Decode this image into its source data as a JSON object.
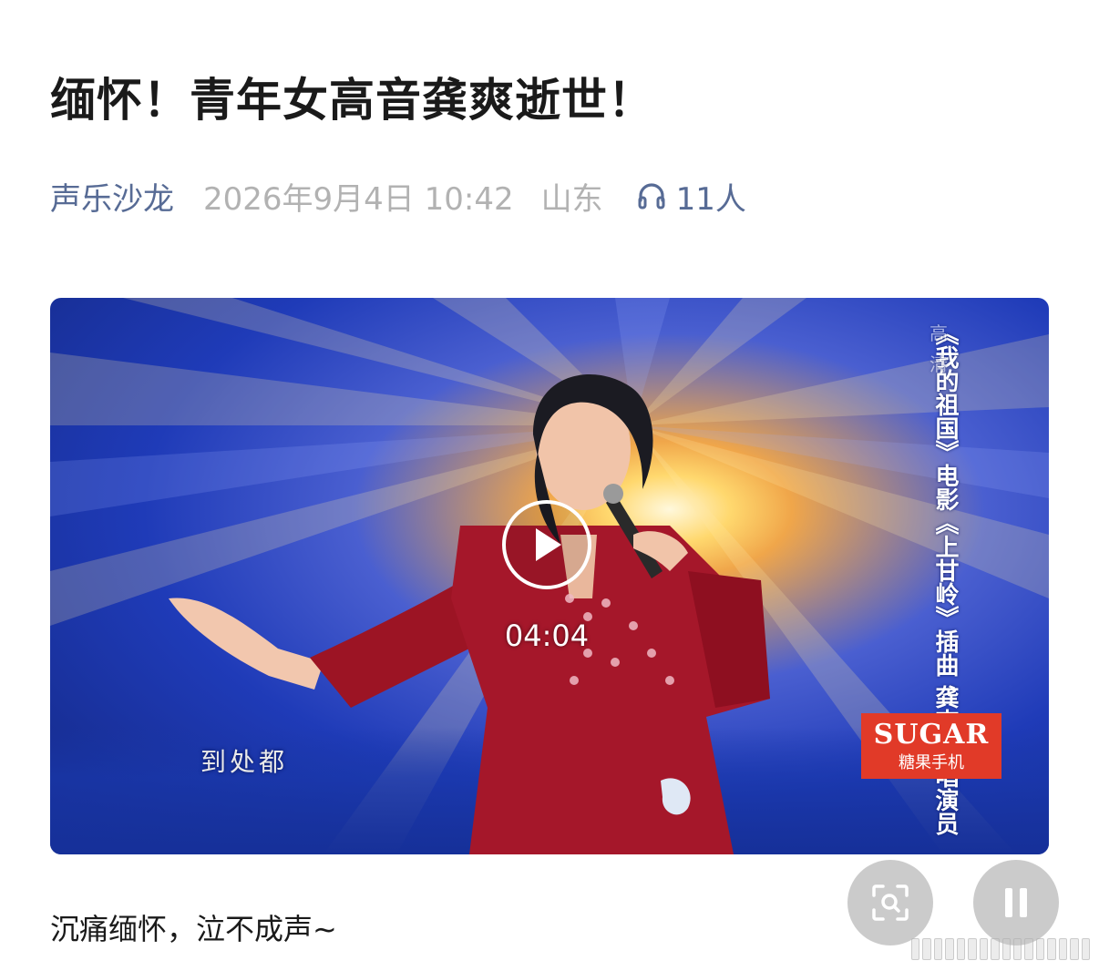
{
  "article": {
    "title": "缅怀！青年女高音龚爽逝世！",
    "account_name": "声乐沙龙",
    "publish_date": "2026年9月4日 10:42",
    "region": "山东",
    "listeners": "11人",
    "body_text": "沉痛缅怀，泣不成声~"
  },
  "video": {
    "duration": "04:04",
    "overlay_quality": "高清",
    "overlay_caption": "《我的祖国》电影《上甘岭》插曲 龚爽 歌唱演员",
    "lyric_subtitle": "到处都",
    "brand_name": "SUGAR",
    "brand_sub": "糖果手机"
  },
  "icons": {
    "listen": "headphones-icon",
    "play": "play-icon",
    "scan": "scan-icon",
    "pause": "pause-icon"
  },
  "colors": {
    "title": "#1a1a1a",
    "account": "#576b95",
    "meta_gray": "#b2b2b2",
    "brand_red": "#e13a28"
  }
}
